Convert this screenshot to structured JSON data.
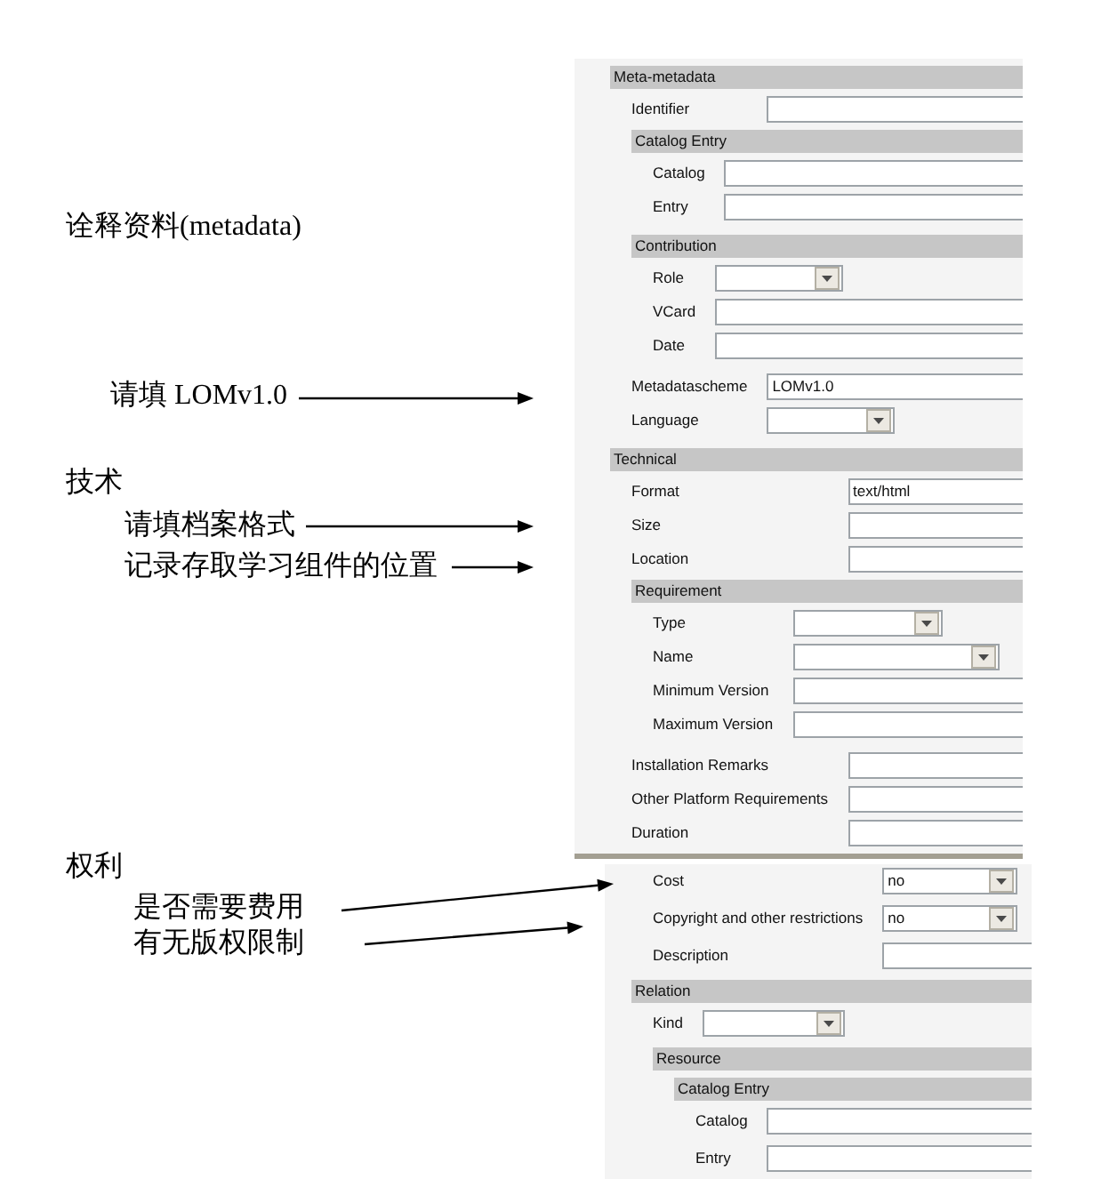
{
  "annotations": [
    {
      "kind": "heading",
      "text": "诠释资料(metadata)"
    },
    {
      "kind": "note",
      "text": "请填 LOMv1.0"
    },
    {
      "kind": "heading",
      "text": "技术"
    },
    {
      "kind": "note",
      "text": "请填档案格式"
    },
    {
      "kind": "note",
      "text": "记录存取学习组件的位置"
    },
    {
      "kind": "heading",
      "text": "权利"
    },
    {
      "kind": "note",
      "text": "是否需要费用"
    },
    {
      "kind": "note",
      "text": "有无版权限制"
    }
  ],
  "upper_screenshot": {
    "items": [
      {
        "kind": "group",
        "title": "Meta-metadata",
        "children": [
          {
            "kind": "text",
            "label": "Identifier"
          },
          {
            "kind": "group",
            "title": "Catalog Entry",
            "children": [
              {
                "kind": "text",
                "label": "Catalog"
              },
              {
                "kind": "text",
                "label": "Entry"
              }
            ]
          },
          {
            "kind": "group",
            "title": "Contribution",
            "children": [
              {
                "kind": "dropdown",
                "label": "Role"
              },
              {
                "kind": "text",
                "label": "VCard"
              },
              {
                "kind": "text",
                "label": "Date"
              }
            ]
          },
          {
            "kind": "text",
            "label": "Metadatascheme",
            "value": "LOMv1.0"
          },
          {
            "kind": "dropdown",
            "label": "Language"
          }
        ]
      },
      {
        "kind": "group",
        "title": "Technical",
        "children": [
          {
            "kind": "text",
            "label": "Format",
            "value": "text/html"
          },
          {
            "kind": "text",
            "label": "Size"
          },
          {
            "kind": "text",
            "label": "Location"
          },
          {
            "kind": "group",
            "title": "Requirement",
            "children": [
              {
                "kind": "dropdown",
                "label": "Type"
              },
              {
                "kind": "dropdown",
                "label": "Name"
              },
              {
                "kind": "text",
                "label": "Minimum Version"
              },
              {
                "kind": "text",
                "label": "Maximum Version"
              }
            ]
          },
          {
            "kind": "text",
            "label": "Installation Remarks"
          },
          {
            "kind": "text",
            "label": "Other Platform Requirements"
          },
          {
            "kind": "text",
            "label": "Duration"
          }
        ]
      }
    ]
  },
  "lower_screenshot": {
    "items": [
      {
        "kind": "dropdown",
        "label": "Cost",
        "value": "no"
      },
      {
        "kind": "dropdown",
        "label": "Copyright and other restrictions",
        "value": "no"
      },
      {
        "kind": "text",
        "label": "Description"
      },
      {
        "kind": "group",
        "title": "Relation",
        "children": [
          {
            "kind": "dropdown",
            "label": "Kind"
          },
          {
            "kind": "group",
            "title": "Resource",
            "children": [
              {
                "kind": "group",
                "title": "Catalog Entry",
                "children": [
                  {
                    "kind": "text",
                    "label": "Catalog"
                  },
                  {
                    "kind": "text",
                    "label": "Entry"
                  }
                ]
              }
            ]
          }
        ]
      }
    ]
  }
}
